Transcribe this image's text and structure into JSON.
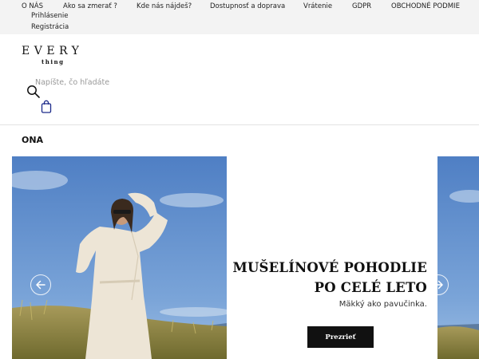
{
  "topnav": {
    "items": [
      "O NÁS",
      "Ako sa zmerať ?",
      "Kde nás nájdeš?",
      "Dostupnosť a doprava",
      "Vrátenie",
      "GDPR",
      "OBCHODNÉ PODMIE"
    ]
  },
  "account": {
    "login": "Prihlásenie",
    "register": "Registrácia"
  },
  "logo": {
    "main": "EVERY",
    "sub": "thing"
  },
  "search": {
    "placeholder": "Napíšte, čo hľadáte"
  },
  "section": {
    "title": "ONA"
  },
  "slide": {
    "headline_line1": "MUŠELÍNOVÉ POHODLIE",
    "headline_line2": "PO CELÉ LETO",
    "subtitle": "Mäkký ako pavučinka.",
    "cta": "Prezrieť"
  },
  "icons": [
    "search-icon",
    "shopping-bag-icon",
    "arrow-left-icon",
    "arrow-right-icon"
  ],
  "colors": {
    "topbar": "#f3f3f3",
    "cta_bg": "#111111",
    "sky": "#5b87c9"
  }
}
